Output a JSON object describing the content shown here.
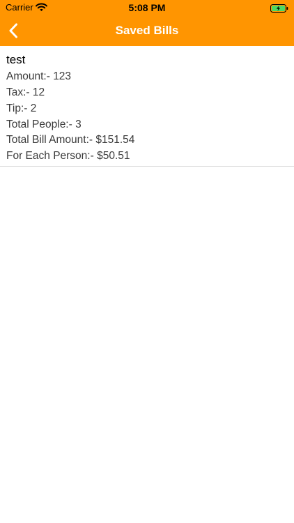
{
  "status_bar": {
    "carrier": "Carrier",
    "time": "5:08 PM",
    "icons": [
      "wifi-icon",
      "battery-charging-icon"
    ]
  },
  "nav": {
    "title": "Saved Bills",
    "back_icon": "chevron-left-icon",
    "color": "#FF9501"
  },
  "bills": [
    {
      "name": "test",
      "amount": "Amount:- 123",
      "tax": "Tax:- 12",
      "tip": "Tip:- 2",
      "total_people": "Total People:- 3",
      "total_bill": "Total Bill Amount:- $151.54",
      "per_person": "For Each Person:- $50.51"
    }
  ]
}
